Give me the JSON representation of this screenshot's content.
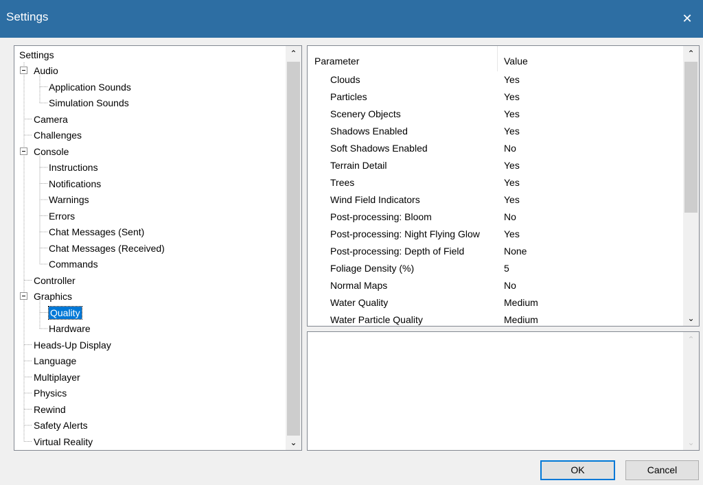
{
  "window": {
    "title": "Settings",
    "close_glyph": "✕"
  },
  "tree": {
    "root": "Settings",
    "items": [
      {
        "label": "Audio",
        "level": 1,
        "expander": true
      },
      {
        "label": "Application Sounds",
        "level": 2
      },
      {
        "label": "Simulation Sounds",
        "level": 2
      },
      {
        "label": "Camera",
        "level": 1
      },
      {
        "label": "Challenges",
        "level": 1
      },
      {
        "label": "Console",
        "level": 1,
        "expander": true
      },
      {
        "label": "Instructions",
        "level": 2
      },
      {
        "label": "Notifications",
        "level": 2
      },
      {
        "label": "Warnings",
        "level": 2
      },
      {
        "label": "Errors",
        "level": 2
      },
      {
        "label": "Chat Messages (Sent)",
        "level": 2
      },
      {
        "label": "Chat Messages (Received)",
        "level": 2
      },
      {
        "label": "Commands",
        "level": 2
      },
      {
        "label": "Controller",
        "level": 1
      },
      {
        "label": "Graphics",
        "level": 1,
        "expander": true
      },
      {
        "label": "Quality",
        "level": 2,
        "selected": true
      },
      {
        "label": "Hardware",
        "level": 2
      },
      {
        "label": "Heads-Up Display",
        "level": 1
      },
      {
        "label": "Language",
        "level": 1
      },
      {
        "label": "Multiplayer",
        "level": 1
      },
      {
        "label": "Physics",
        "level": 1
      },
      {
        "label": "Rewind",
        "level": 1
      },
      {
        "label": "Safety Alerts",
        "level": 1
      },
      {
        "label": "Virtual Reality",
        "level": 1
      }
    ]
  },
  "params": {
    "header_parameter": "Parameter",
    "header_value": "Value",
    "rows": [
      {
        "parameter": "Clouds",
        "value": "Yes"
      },
      {
        "parameter": "Particles",
        "value": "Yes"
      },
      {
        "parameter": "Scenery Objects",
        "value": "Yes"
      },
      {
        "parameter": "Shadows Enabled",
        "value": "Yes"
      },
      {
        "parameter": "Soft Shadows Enabled",
        "value": "No"
      },
      {
        "parameter": "Terrain Detail",
        "value": "Yes"
      },
      {
        "parameter": "Trees",
        "value": "Yes"
      },
      {
        "parameter": "Wind Field Indicators",
        "value": "Yes"
      },
      {
        "parameter": "Post-processing: Bloom",
        "value": "No"
      },
      {
        "parameter": "Post-processing: Night Flying Glow",
        "value": "Yes"
      },
      {
        "parameter": "Post-processing: Depth of Field",
        "value": "None"
      },
      {
        "parameter": "Foliage Density (%)",
        "value": "5"
      },
      {
        "parameter": "Normal Maps",
        "value": "No"
      },
      {
        "parameter": "Water Quality",
        "value": "Medium"
      },
      {
        "parameter": "Water Particle Quality",
        "value": "Medium"
      }
    ]
  },
  "buttons": {
    "ok": "OK",
    "cancel": "Cancel"
  },
  "icons": {
    "scroll_up": "⌃",
    "scroll_down": "⌄"
  },
  "colors": {
    "titlebar": "#2d6ea3",
    "selection": "#0078d7"
  }
}
